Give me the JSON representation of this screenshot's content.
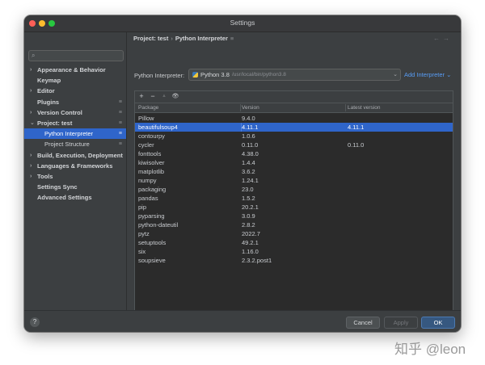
{
  "window": {
    "title": "Settings"
  },
  "sidebar": {
    "search_icon": "search-icon",
    "items": [
      {
        "label": "Appearance & Behavior",
        "arrow": "›",
        "bold": true
      },
      {
        "label": "Keymap",
        "arrow": "",
        "bold": true
      },
      {
        "label": "Editor",
        "arrow": "›",
        "bold": true
      },
      {
        "label": "Plugins",
        "arrow": "",
        "bold": true,
        "cfg": "≡"
      },
      {
        "label": "Version Control",
        "arrow": "›",
        "bold": true,
        "cfg": "≡"
      },
      {
        "label": "Project: test",
        "arrow": "⌄",
        "bold": true,
        "cfg": "≡"
      },
      {
        "label": "Python Interpreter",
        "arrow": "",
        "child": true,
        "selected": true,
        "cfg": "≡"
      },
      {
        "label": "Project Structure",
        "arrow": "",
        "child": true,
        "cfg": "≡"
      },
      {
        "label": "Build, Execution, Deployment",
        "arrow": "›",
        "bold": true
      },
      {
        "label": "Languages & Frameworks",
        "arrow": "›",
        "bold": true
      },
      {
        "label": "Tools",
        "arrow": "›",
        "bold": true
      },
      {
        "label": "Settings Sync",
        "arrow": "",
        "bold": true
      },
      {
        "label": "Advanced Settings",
        "arrow": "",
        "bold": true
      }
    ]
  },
  "breadcrumb": {
    "parent": "Project: test",
    "sep": "›",
    "current": "Python Interpreter",
    "cfg": "≡"
  },
  "nav": {
    "arrows": "←→"
  },
  "interpreter": {
    "label": "Python Interpreter:",
    "name": "Python 3.8",
    "path": "/usr/local/bin/python3.8",
    "caret": "⌄",
    "add_label": "Add Interpreter ⌄"
  },
  "toolbar": {
    "add": "+",
    "remove": "−",
    "up": "▲",
    "show": "👁"
  },
  "table": {
    "headers": [
      "Package",
      "Version",
      "Latest version"
    ],
    "rows": [
      [
        "Pillow",
        "9.4.0",
        ""
      ],
      [
        "beautifulsoup4",
        "4.11.1",
        "4.11.1"
      ],
      [
        "contourpy",
        "1.0.6",
        ""
      ],
      [
        "cycler",
        "0.11.0",
        "0.11.0"
      ],
      [
        "fonttools",
        "4.38.0",
        ""
      ],
      [
        "kiwisolver",
        "1.4.4",
        ""
      ],
      [
        "matplotlib",
        "3.6.2",
        ""
      ],
      [
        "numpy",
        "1.24.1",
        ""
      ],
      [
        "packaging",
        "23.0",
        ""
      ],
      [
        "pandas",
        "1.5.2",
        ""
      ],
      [
        "pip",
        "20.2.1",
        ""
      ],
      [
        "pyparsing",
        "3.0.9",
        ""
      ],
      [
        "python-dateutil",
        "2.8.2",
        ""
      ],
      [
        "pytz",
        "2022.7",
        ""
      ],
      [
        "setuptools",
        "49.2.1",
        ""
      ],
      [
        "six",
        "1.16.0",
        ""
      ],
      [
        "soupsieve",
        "2.3.2.post1",
        ""
      ]
    ],
    "selected_index": 1
  },
  "footer": {
    "help": "?",
    "cancel": "Cancel",
    "apply": "Apply",
    "ok": "OK"
  },
  "watermark": "知乎 @leon"
}
